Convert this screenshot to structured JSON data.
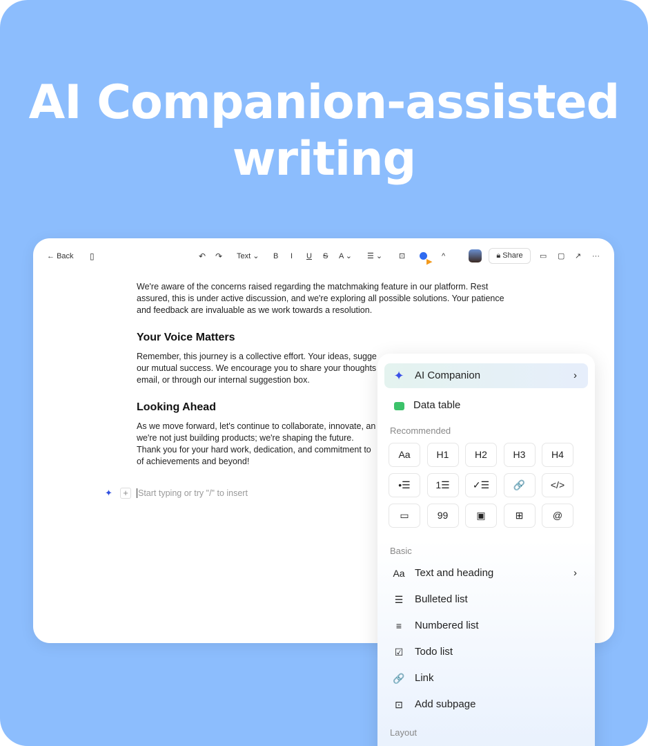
{
  "hero": {
    "line1": "AI Companion-assisted",
    "line2": "writing"
  },
  "toolbar": {
    "back": "Back",
    "text_style": "Text",
    "share": "Share",
    "icons": [
      "sidebar-icon",
      "undo-icon",
      "redo-icon",
      "bold-icon",
      "italic-icon",
      "underline-icon",
      "strikethrough-icon",
      "font-color-icon",
      "align-icon",
      "comment-add-icon",
      "ai-companion-icon",
      "collapse-icon",
      "avatar",
      "lock-icon",
      "video-icon",
      "chat-icon",
      "open-external-icon",
      "more-icon"
    ]
  },
  "doc": {
    "p1": "We're aware of the concerns raised regarding the matchmaking feature in our platform. Rest assured, this is under active discussion, and we're exploring all possible solutions. Your patience and feedback are invaluable as we work towards a resolution.",
    "h1": "Your Voice Matters",
    "p2": "Remember, this journey is a collective effort. Your ideas, sugge",
    "p2b": "our mutual success. We encourage you to share your thoughts",
    "p2c": "email, or through our internal suggestion box.",
    "h2": "Looking Ahead",
    "p3a": "As we move forward, let's continue to collaborate, innovate, an",
    "p3b": "we're not just building products; we're shaping the future.",
    "p3c": "Thank you for your hard work, dedication, and commitment to",
    "p3d": "of achievements and beyond!",
    "placeholder": "Start typing or try \"/\" to insert"
  },
  "menu": {
    "ai": "AI Companion",
    "data_table": "Data table",
    "recommended": "Recommended",
    "grid": [
      "Aa",
      "H1",
      "H2",
      "H3",
      "H4",
      "•☰",
      "1☰",
      "✓☰",
      "🔗",
      "</>",
      "▭",
      "99",
      "▣",
      "⊞",
      "@"
    ],
    "basic": "Basic",
    "basic_items": [
      {
        "icon": "Aa",
        "label": "Text and heading"
      },
      {
        "icon": "☰",
        "label": "Bulleted list"
      },
      {
        "icon": "≡",
        "label": "Numbered list"
      },
      {
        "icon": "☑",
        "label": "Todo list"
      },
      {
        "icon": "🔗",
        "label": "Link"
      },
      {
        "icon": "⊡",
        "label": "Add subpage"
      }
    ],
    "layout": "Layout"
  },
  "colors": {
    "background": "#8cbdfd",
    "accent": "#2f6bf0",
    "data_table": "#3cc26a"
  }
}
